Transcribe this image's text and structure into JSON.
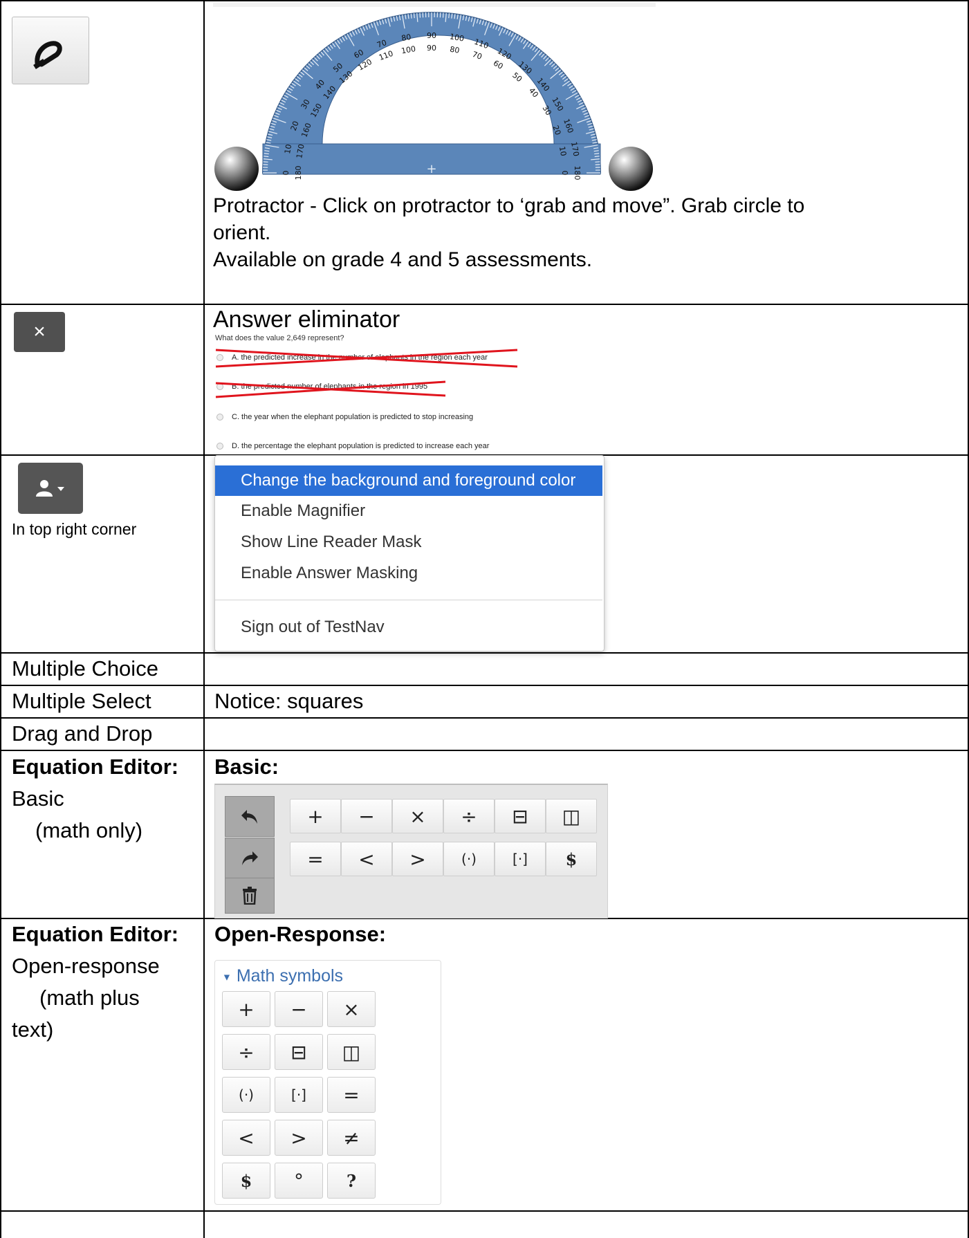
{
  "protractor": {
    "caption_line1": "Protractor - Click on protractor to ‘grab and move”.  Grab circle to",
    "caption_line2": "orient.",
    "caption_line3": "Available on grade 4 and 5 assessments.",
    "outer_ticks": [
      "0",
      "10",
      "20",
      "30",
      "40",
      "50",
      "60",
      "70",
      "80",
      "90",
      "100",
      "110",
      "120",
      "130",
      "140",
      "150",
      "160",
      "170",
      "180"
    ],
    "inner_ticks": [
      "180",
      "170",
      "160",
      "150",
      "140",
      "130",
      "120",
      "110",
      "100",
      "90",
      "80",
      "70",
      "60",
      "50",
      "40",
      "30",
      "20",
      "10",
      "0"
    ]
  },
  "eliminator": {
    "title": "Answer eliminator",
    "question": "What does the value 2,649 represent?",
    "options": [
      {
        "text": "A.  the predicted increase in the number of elephants in the region each year",
        "struck": true
      },
      {
        "text": "B.  the predicted number of elephants in the region in 1995",
        "struck": true
      },
      {
        "text": "C.  the year when the elephant population is predicted to stop increasing",
        "struck": false
      },
      {
        "text": "D.  the percentage the elephant population is predicted to increase each year",
        "struck": false
      }
    ],
    "button_symbol": "×"
  },
  "user_menu": {
    "note": "In top right corner",
    "items": [
      "Change the background and foreground color",
      "Enable Magnifier",
      "Show Line Reader Mask",
      "Enable Answer Masking",
      "Sign out of TestNav"
    ]
  },
  "rows": {
    "multiple_choice": "Multiple Choice",
    "multiple_select": "Multiple Select",
    "multiple_select_note": "Notice:  squares",
    "drag_drop": "Drag and Drop"
  },
  "equation_basic": {
    "label_bold": "Equation Editor:",
    "label_1": "Basic",
    "label_2": "(math only)",
    "heading": "Basic:",
    "keys_row1": [
      "+",
      "−",
      "×",
      "÷",
      "⊟",
      "◫"
    ],
    "keys_row2": [
      "=",
      "<",
      ">",
      "(·)",
      "[·]",
      "$"
    ]
  },
  "equation_open": {
    "label_bold": "Equation Editor:",
    "label_1": "Open-response",
    "label_2": "(math plus",
    "label_3": "text)",
    "heading": "Open-Response:",
    "panel_title": "Math symbols",
    "keys": [
      [
        "+",
        "−",
        "×"
      ],
      [
        "÷",
        "⊟",
        "◫"
      ],
      [
        "(·)",
        "[·]",
        "="
      ],
      [
        "<",
        ">",
        "≠"
      ],
      [
        "$",
        "°",
        "?"
      ]
    ]
  }
}
